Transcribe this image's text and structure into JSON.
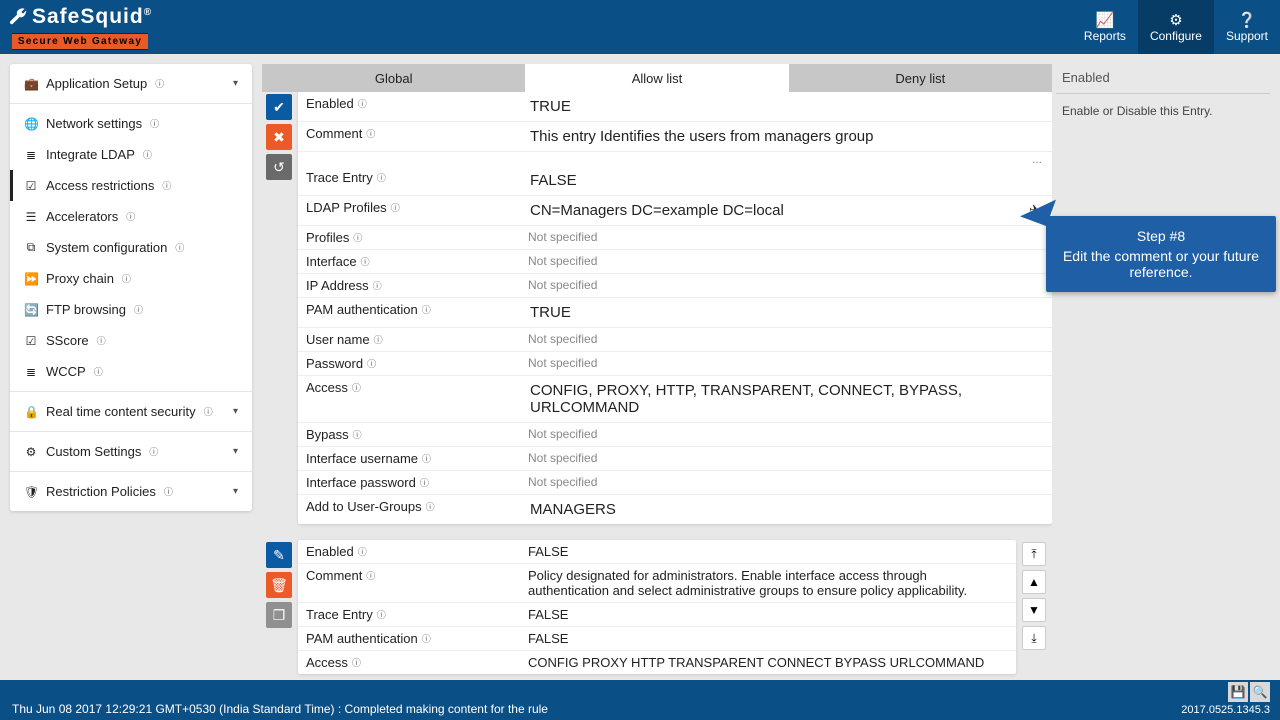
{
  "header": {
    "brand": "SafeSquid",
    "brand_suffix": "®",
    "tagline": "Secure Web Gateway",
    "nav": {
      "reports": "Reports",
      "configure": "Configure",
      "support": "Support"
    }
  },
  "sidebar": {
    "items": [
      {
        "icon": "briefcase",
        "label": "Application Setup",
        "header": true
      },
      {
        "icon": "globe",
        "label": "Network settings"
      },
      {
        "icon": "list",
        "label": "Integrate LDAP"
      },
      {
        "icon": "check",
        "label": "Access restrictions",
        "active": true
      },
      {
        "icon": "stack",
        "label": "Accelerators"
      },
      {
        "icon": "sliders",
        "label": "System configuration"
      },
      {
        "icon": "ff",
        "label": "Proxy chain"
      },
      {
        "icon": "refresh",
        "label": "FTP browsing"
      },
      {
        "icon": "check",
        "label": "SScore"
      },
      {
        "icon": "list",
        "label": "WCCP"
      },
      {
        "icon": "lock",
        "label": "Real time content security",
        "header": true
      },
      {
        "icon": "sliders",
        "label": "Custom Settings",
        "header": true
      },
      {
        "icon": "shield",
        "label": "Restriction Policies",
        "header": true
      }
    ]
  },
  "tabs": {
    "global": "Global",
    "allow": "Allow list",
    "deny": "Deny list"
  },
  "labels": {
    "enabled": "Enabled",
    "comment": "Comment",
    "trace_entry": "Trace Entry",
    "ldap_profiles": "LDAP Profiles",
    "profiles": "Profiles",
    "interface": "Interface",
    "ip_address": "IP Address",
    "pam_auth": "PAM authentication",
    "user_name": "User name",
    "password": "Password",
    "access": "Access",
    "bypass": "Bypass",
    "iface_user": "Interface username",
    "iface_pass": "Interface password",
    "add_groups": "Add to User-Groups"
  },
  "entry1": {
    "enabled": "TRUE",
    "comment": "This entry Identifies the users from managers group",
    "trace_entry": "FALSE",
    "ldap_profiles": "CN=Managers DC=example DC=local",
    "profiles": "Not specified",
    "interface": "Not specified",
    "ip_address": "Not specified",
    "pam_auth": "TRUE",
    "user_name": "Not specified",
    "password": "Not specified",
    "access": "CONFIG, PROXY, HTTP, TRANSPARENT, CONNECT, BYPASS, URLCOMMAND",
    "bypass": "Not specified",
    "iface_user": "Not specified",
    "iface_pass": "Not specified",
    "add_groups": "MANAGERS"
  },
  "entry2": {
    "enabled": "FALSE",
    "comment": "Policy designated for administrators. Enable interface access through authentication and select administrative groups to ensure policy applicability.",
    "trace_entry": "FALSE",
    "pam_auth": "FALSE",
    "access": "CONFIG PROXY HTTP TRANSPARENT CONNECT BYPASS URLCOMMAND"
  },
  "help": {
    "title": "Enabled",
    "text": "Enable or Disable this Entry."
  },
  "callout": {
    "step": "Step #8",
    "text": "Edit the comment or your future reference."
  },
  "status": {
    "text": "Thu Jun 08 2017 12:29:21 GMT+0530 (India Standard Time) : Completed making content for the rule",
    "version": "2017.0525.1345.3"
  },
  "not_specified": "Not specified",
  "ellipsis": "..."
}
